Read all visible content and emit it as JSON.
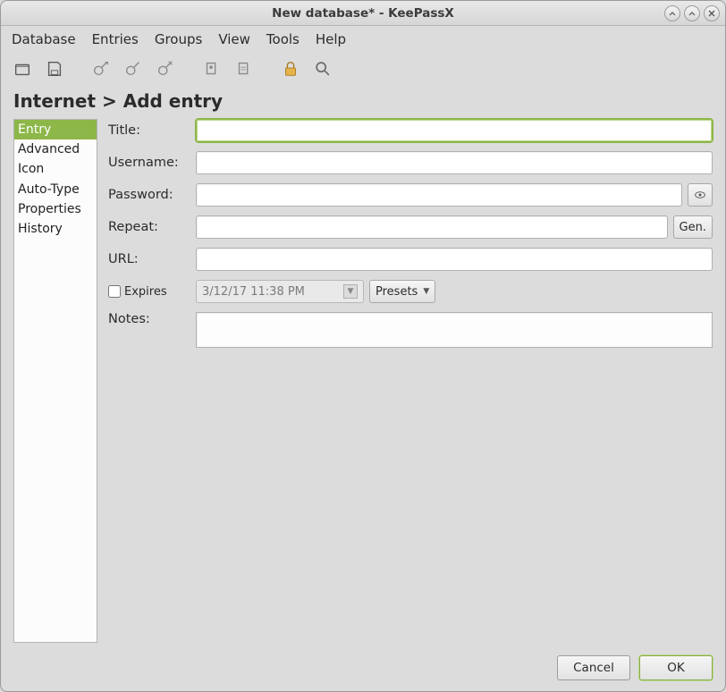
{
  "titlebar": {
    "title": "New database* - KeePassX"
  },
  "menubar": [
    "Database",
    "Entries",
    "Groups",
    "View",
    "Tools",
    "Help"
  ],
  "heading": "Internet > Add entry",
  "sidebar": {
    "items": [
      "Entry",
      "Advanced",
      "Icon",
      "Auto-Type",
      "Properties",
      "History"
    ],
    "selected": 0
  },
  "form": {
    "title_label": "Title:",
    "title_value": "",
    "username_label": "Username:",
    "username_value": "",
    "password_label": "Password:",
    "password_value": "",
    "repeat_label": "Repeat:",
    "repeat_value": "",
    "gen_label": "Gen.",
    "url_label": "URL:",
    "url_value": "",
    "expires_label": "Expires",
    "expires_checked": false,
    "expires_value": "3/12/17 11:38 PM",
    "presets_label": "Presets",
    "notes_label": "Notes:",
    "notes_value": ""
  },
  "buttons": {
    "cancel": "Cancel",
    "ok": "OK"
  }
}
